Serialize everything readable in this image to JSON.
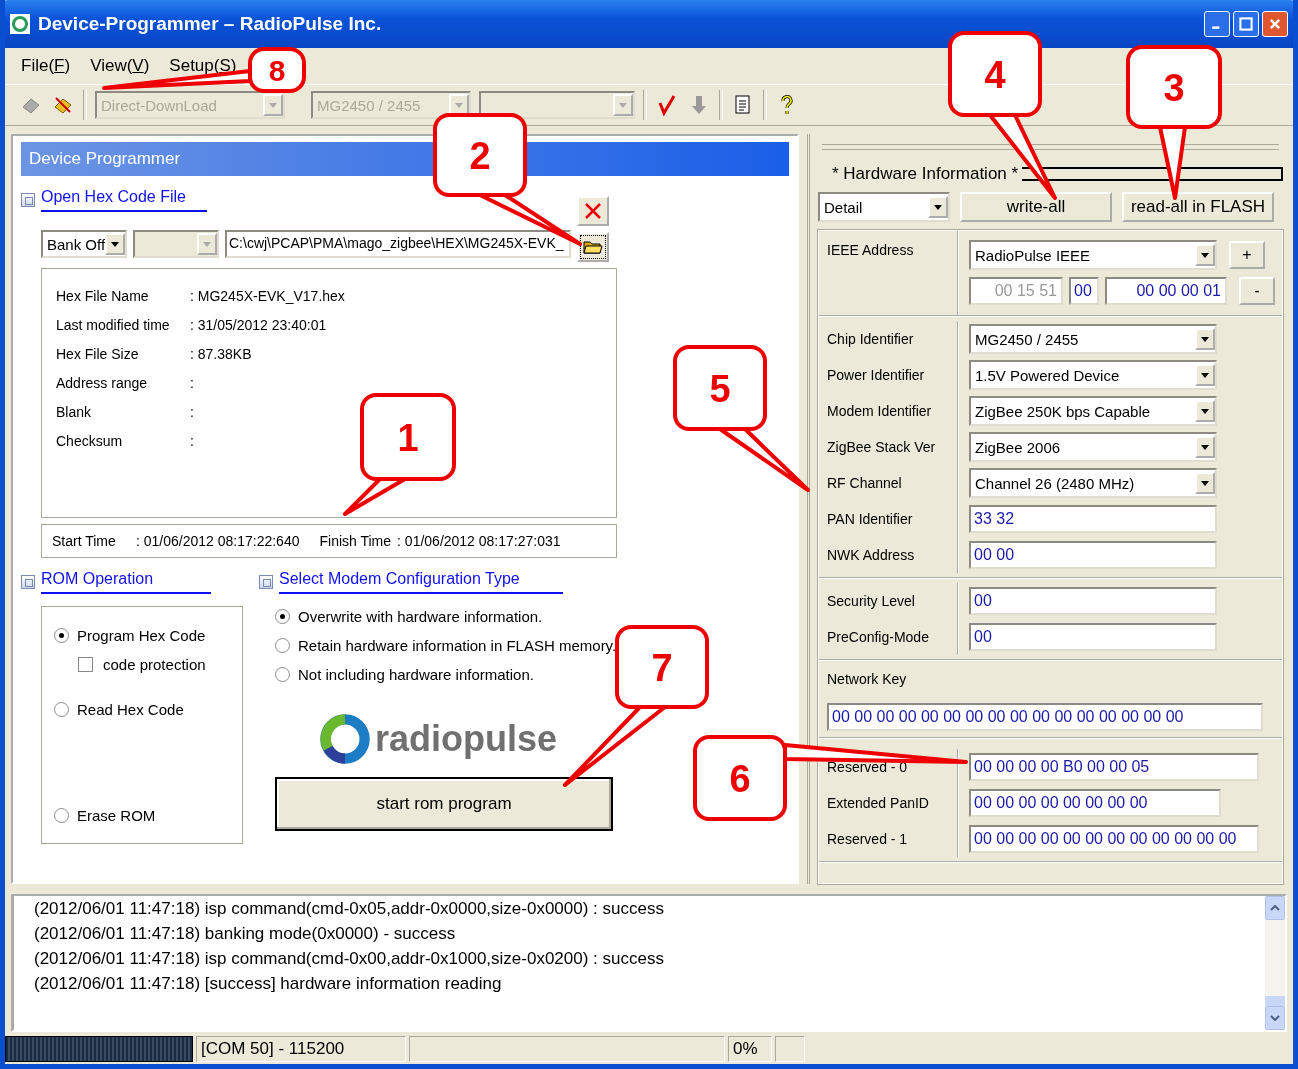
{
  "window": {
    "title": "Device-Programmer – RadioPulse Inc."
  },
  "menu": [
    {
      "label": "File(F)"
    },
    {
      "label": "View(V)"
    },
    {
      "label": "Setup(S)"
    }
  ],
  "toolbar": {
    "combos": [
      {
        "value": "Direct-DownLoad",
        "disabled": true
      },
      {
        "value": "MG2450 / 2455",
        "disabled": true
      },
      {
        "disabled": true
      }
    ]
  },
  "panel_title": "Device Programmer",
  "hex_section": {
    "title": "Open Hex Code File",
    "bank": "Bank Off",
    "path": "C:\\cwj\\PCAP\\PMA\\mago_zigbee\\HEX\\MG245X-EVK_",
    "info": [
      {
        "label": "Hex File Name",
        "value": ": MG245X-EVK_V17.hex"
      },
      {
        "label": "Last modified time",
        "value": ": 31/05/2012  23:40:01"
      },
      {
        "label": "Hex File Size",
        "value": ": 87.38KB"
      },
      {
        "label": "Address range",
        "value": ":"
      },
      {
        "label": "Blank",
        "value": ":"
      },
      {
        "label": "Checksum",
        "value": ":"
      }
    ],
    "start": {
      "label": "Start Time",
      "value": ": 01/06/2012  08:17:22:640"
    },
    "finish": {
      "label": "Finish Time",
      "value": ": 01/06/2012  08:17:27:031"
    }
  },
  "rom_operation": {
    "title": "ROM Operation",
    "options": [
      {
        "label": "Program Hex Code",
        "selected": true
      },
      {
        "label": "Read Hex Code",
        "selected": false
      },
      {
        "label": "Erase ROM",
        "selected": false
      }
    ],
    "code_protection": {
      "label": "code protection",
      "checked": false
    }
  },
  "modem_config": {
    "title": "Select Modem Configuration Type",
    "options": [
      {
        "label": "Overwrite with hardware information.",
        "selected": true
      },
      {
        "label": "Retain hardware information in FLASH memory.",
        "selected": false
      },
      {
        "label": "Not including hardware information.",
        "selected": false
      }
    ]
  },
  "logo": {
    "text": "radiopulse"
  },
  "start_button": "start rom program",
  "hardware": {
    "title": "* Hardware Information *",
    "view": "Detail",
    "buttons": [
      "write-all",
      "read-all in FLASH"
    ],
    "ieee": {
      "label": "IEEE Address",
      "preset": "RadioPulse IEEE",
      "oui": "00 15 51",
      "byte": "00",
      "serial": "00 00 00 01",
      "plus": "+",
      "minus": "-"
    },
    "groups": [
      {
        "rows": [
          {
            "kind": "select",
            "label": "Chip Identifier",
            "value": "MG2450 / 2455"
          },
          {
            "kind": "select",
            "label": "Power Identifier",
            "value": "1.5V Powered Device"
          },
          {
            "kind": "select",
            "label": "Modem Identifier",
            "value": "ZigBee 250K bps Capable"
          },
          {
            "kind": "select",
            "label": "ZigBee Stack Ver",
            "value": "ZigBee 2006"
          },
          {
            "kind": "select",
            "label": "RF Channel",
            "value": "Channel 26 (2480 MHz)"
          },
          {
            "kind": "field",
            "label": "PAN Identifier",
            "value": "33 32"
          },
          {
            "kind": "field",
            "label": "NWK Address",
            "value": "00 00"
          }
        ]
      },
      {
        "rows": [
          {
            "kind": "field",
            "label": "Security Level",
            "value": "00"
          },
          {
            "kind": "field",
            "label": "PreConfig-Mode",
            "value": "00"
          }
        ]
      }
    ],
    "network_key": {
      "label": "Network Key",
      "value": "00 00 00 00 00 00 00 00 00 00 00 00 00 00 00 00"
    },
    "reserved": [
      {
        "label": "Reserved - 0",
        "value": "00 00 00 00 B0 00 00 05",
        "wide": true
      },
      {
        "label": "Extended PanID",
        "value": "00 00 00 00 00 00 00 00",
        "wide": false
      },
      {
        "label": "Reserved - 1",
        "value": "00 00 00 00 00 00 00 00 00 00 00 00",
        "wide": true
      }
    ]
  },
  "log": [
    "(2012/06/01 11:47:18) isp command(cmd-0x05,addr-0x0000,size-0x0000) : success",
    "(2012/06/01 11:47:18) banking mode(0x0000) - success",
    "(2012/06/01 11:47:18) isp command(cmd-0x00,addr-0x1000,size-0x0200) : success",
    "(2012/06/01 11:47:18) [success] hardware information reading"
  ],
  "status_bar": {
    "port": "[COM 50] - 115200",
    "percent": "0%"
  },
  "callouts": [
    {
      "number": "8"
    },
    {
      "number": "2"
    },
    {
      "number": "4"
    },
    {
      "number": "3"
    },
    {
      "number": "1"
    },
    {
      "number": "5"
    },
    {
      "number": "7"
    },
    {
      "number": "6"
    }
  ]
}
